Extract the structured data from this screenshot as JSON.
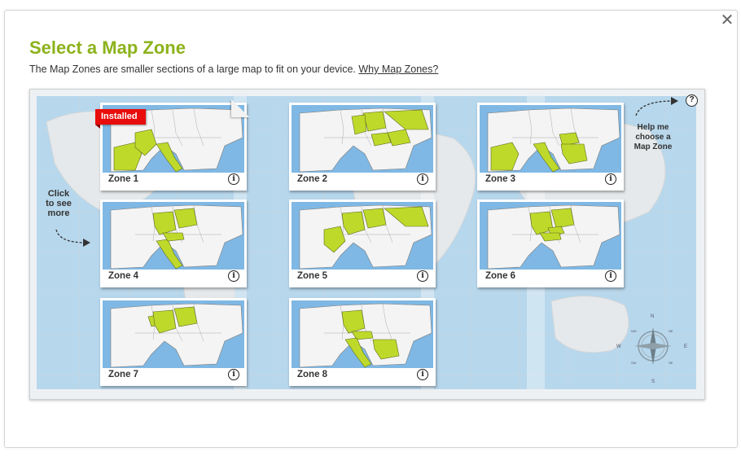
{
  "dialog": {
    "close_glyph": "✕",
    "title": "Select a Map Zone",
    "subtitle": "The Map Zones are smaller sections of a large map to fit on your device.",
    "why_link": "Why Map Zones?"
  },
  "navigation": {
    "click_more": [
      "Click",
      "to see",
      "more"
    ],
    "help_glyph": "?",
    "help_text": [
      "Help me",
      "choose a",
      "Map Zone"
    ]
  },
  "compass": {
    "n": "N",
    "s": "S",
    "e": "E",
    "w": "W",
    "ne": "NE",
    "nw": "NW",
    "se": "SE",
    "sw": "SW"
  },
  "colors": {
    "accent": "#8cb21b",
    "highlight": "#bfd92b",
    "sea": "#7fb8e4",
    "land": "#f4f4f4",
    "installed": "#e80c0c"
  },
  "zones": [
    {
      "label": "Zone 1",
      "installed": true,
      "badge": "Installed",
      "info": "i",
      "highlight": [
        "iberia",
        "france",
        "italy"
      ]
    },
    {
      "label": "Zone 2",
      "installed": false,
      "info": "i",
      "highlight": [
        "poland",
        "germany_east",
        "hungary",
        "romania",
        "ukraine"
      ]
    },
    {
      "label": "Zone 3",
      "installed": false,
      "info": "i",
      "highlight": [
        "iberia",
        "italy",
        "hungary",
        "balkans"
      ]
    },
    {
      "label": "Zone 4",
      "installed": false,
      "info": "i",
      "highlight": [
        "germany",
        "poland",
        "italy",
        "austria"
      ]
    },
    {
      "label": "Zone 5",
      "installed": false,
      "info": "i",
      "highlight": [
        "france",
        "germany",
        "poland",
        "ukraine"
      ]
    },
    {
      "label": "Zone 6",
      "installed": false,
      "info": "i",
      "highlight": [
        "germany",
        "poland",
        "czech",
        "austria"
      ]
    },
    {
      "label": "Zone 7",
      "installed": false,
      "info": "i",
      "highlight": [
        "benelux",
        "germany",
        "poland"
      ]
    },
    {
      "label": "Zone 8",
      "installed": false,
      "info": "i",
      "highlight": [
        "germany",
        "austria",
        "italy",
        "balkans"
      ]
    }
  ]
}
